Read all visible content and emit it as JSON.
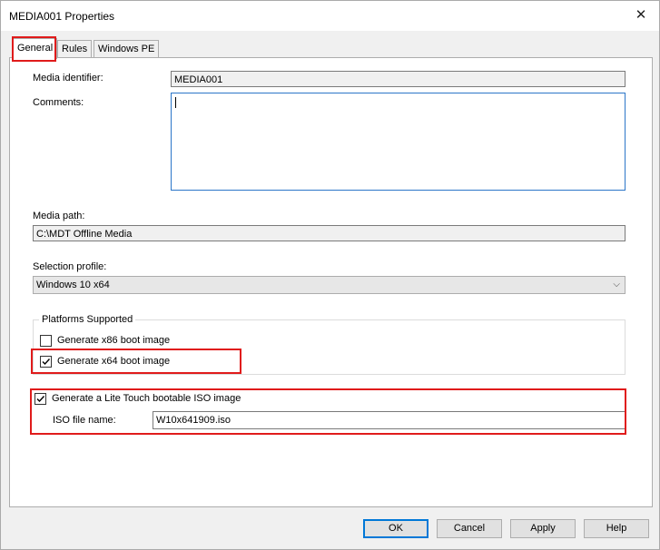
{
  "window": {
    "title": "MEDIA001 Properties",
    "close_glyph": "✕"
  },
  "tabs": [
    {
      "label": "General",
      "active": true
    },
    {
      "label": "Rules",
      "active": false
    },
    {
      "label": "Windows PE",
      "active": false
    }
  ],
  "general": {
    "media_identifier_label": "Media identifier:",
    "media_identifier_value": "MEDIA001",
    "comments_label": "Comments:",
    "comments_value": "",
    "media_path_label": "Media path:",
    "media_path_value": "C:\\MDT Offline Media",
    "selection_profile_label": "Selection profile:",
    "selection_profile_value": "Windows 10 x64",
    "platforms_group_title": "Platforms Supported",
    "x86_label": "Generate x86 boot image",
    "x86_checked": false,
    "x64_label": "Generate x64 boot image",
    "x64_checked": true,
    "iso_label": "Generate a Lite Touch bootable ISO image",
    "iso_checked": true,
    "iso_file_label": "ISO file name:",
    "iso_file_value": "W10x641909.iso"
  },
  "buttons": {
    "ok": "OK",
    "cancel": "Cancel",
    "apply": "Apply",
    "help": "Help"
  },
  "colors": {
    "highlight": "#e01b1b",
    "focus_blue": "#0078d7"
  }
}
